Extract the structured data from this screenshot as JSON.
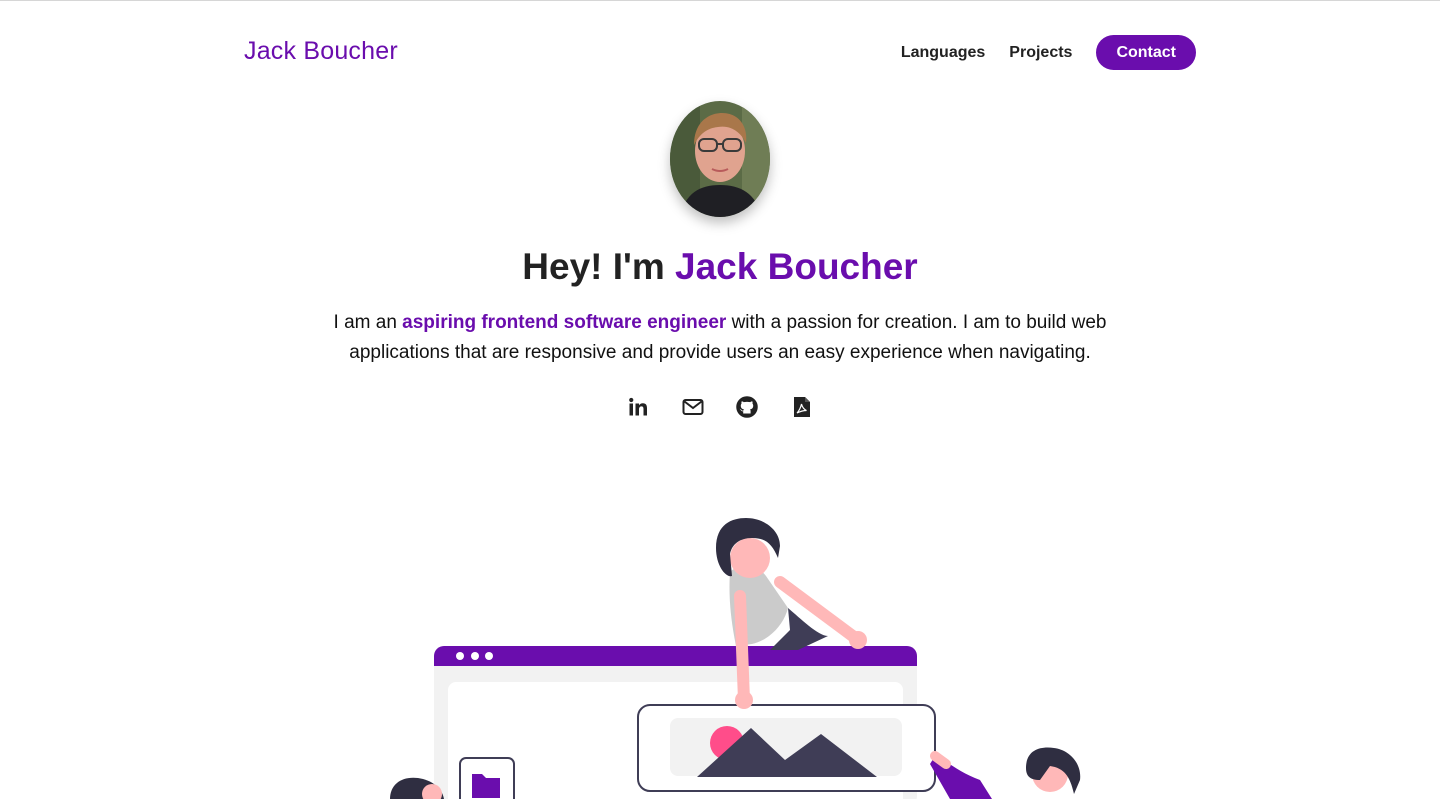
{
  "header": {
    "brand": "Jack Boucher",
    "nav": {
      "languages": "Languages",
      "projects": "Projects",
      "contact": "Contact"
    }
  },
  "hero": {
    "avatar_icon": "profile-photo",
    "greeting": "Hey! I'm",
    "name": "Jack Boucher",
    "intro_before": "I am an",
    "intro_highlight": "aspiring frontend software engineer",
    "intro_after": "with a passion for creation. I am to build web applications that are responsive and provide users an easy experience when navigating."
  },
  "socials": [
    {
      "icon": "linkedin-icon"
    },
    {
      "icon": "mail-icon"
    },
    {
      "icon": "github-icon"
    },
    {
      "icon": "pdf-icon"
    }
  ],
  "colors": {
    "accent": "#6a0dad",
    "text": "#222222",
    "illustration_pink": "#ff4d8a",
    "illustration_dark": "#3f3d56",
    "skin": "#ffb8b8"
  }
}
